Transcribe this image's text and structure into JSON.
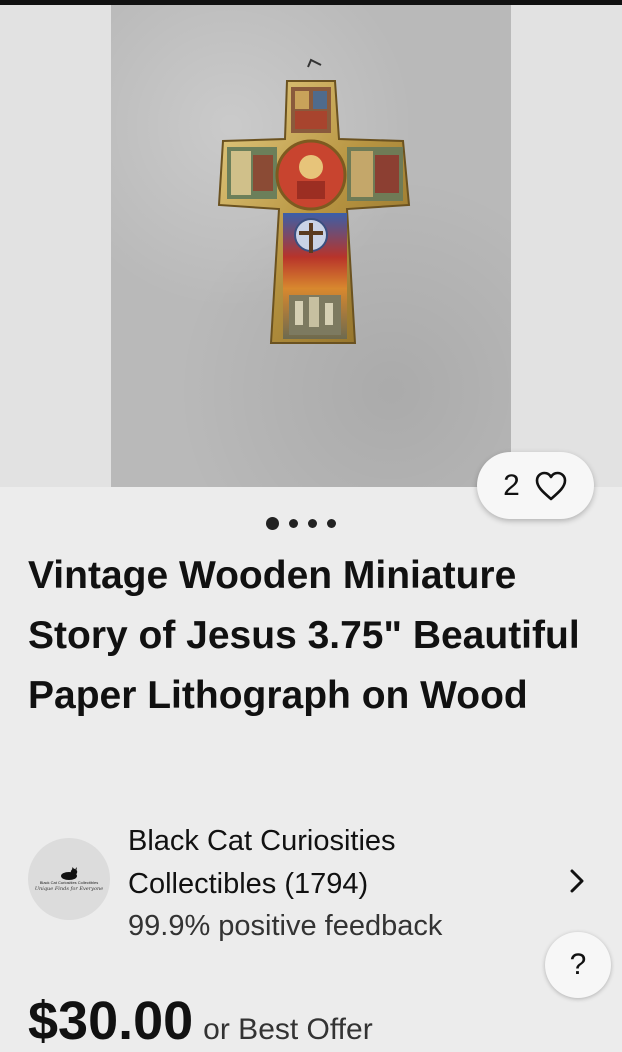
{
  "gallery": {
    "image_alt": "Vintage wooden cross with paper lithograph scenes",
    "image_count": 4,
    "active_index": 0,
    "watchers_count": "2",
    "heart_icon": "heart-outline-icon"
  },
  "listing": {
    "title": "Vintage Wooden Miniature Story of Jesus 3.75\" Beautiful Paper Lithograph on Wood",
    "price": "$30.00",
    "price_suffix": "or Best Offer"
  },
  "seller": {
    "name_line1": "Black Cat Curiosities",
    "name_line2": "Collectibles (1794)",
    "feedback": "99.9% positive feedback",
    "avatar_line1": "Black Cat Curiosities Collectibles",
    "avatar_line2": "Unique Finds for Everyone",
    "chevron_icon": "chevron-right-icon"
  },
  "help": {
    "label": "?"
  },
  "colors": {
    "background": "#ececec",
    "text": "#111111",
    "pill": "#f7f7f7"
  }
}
